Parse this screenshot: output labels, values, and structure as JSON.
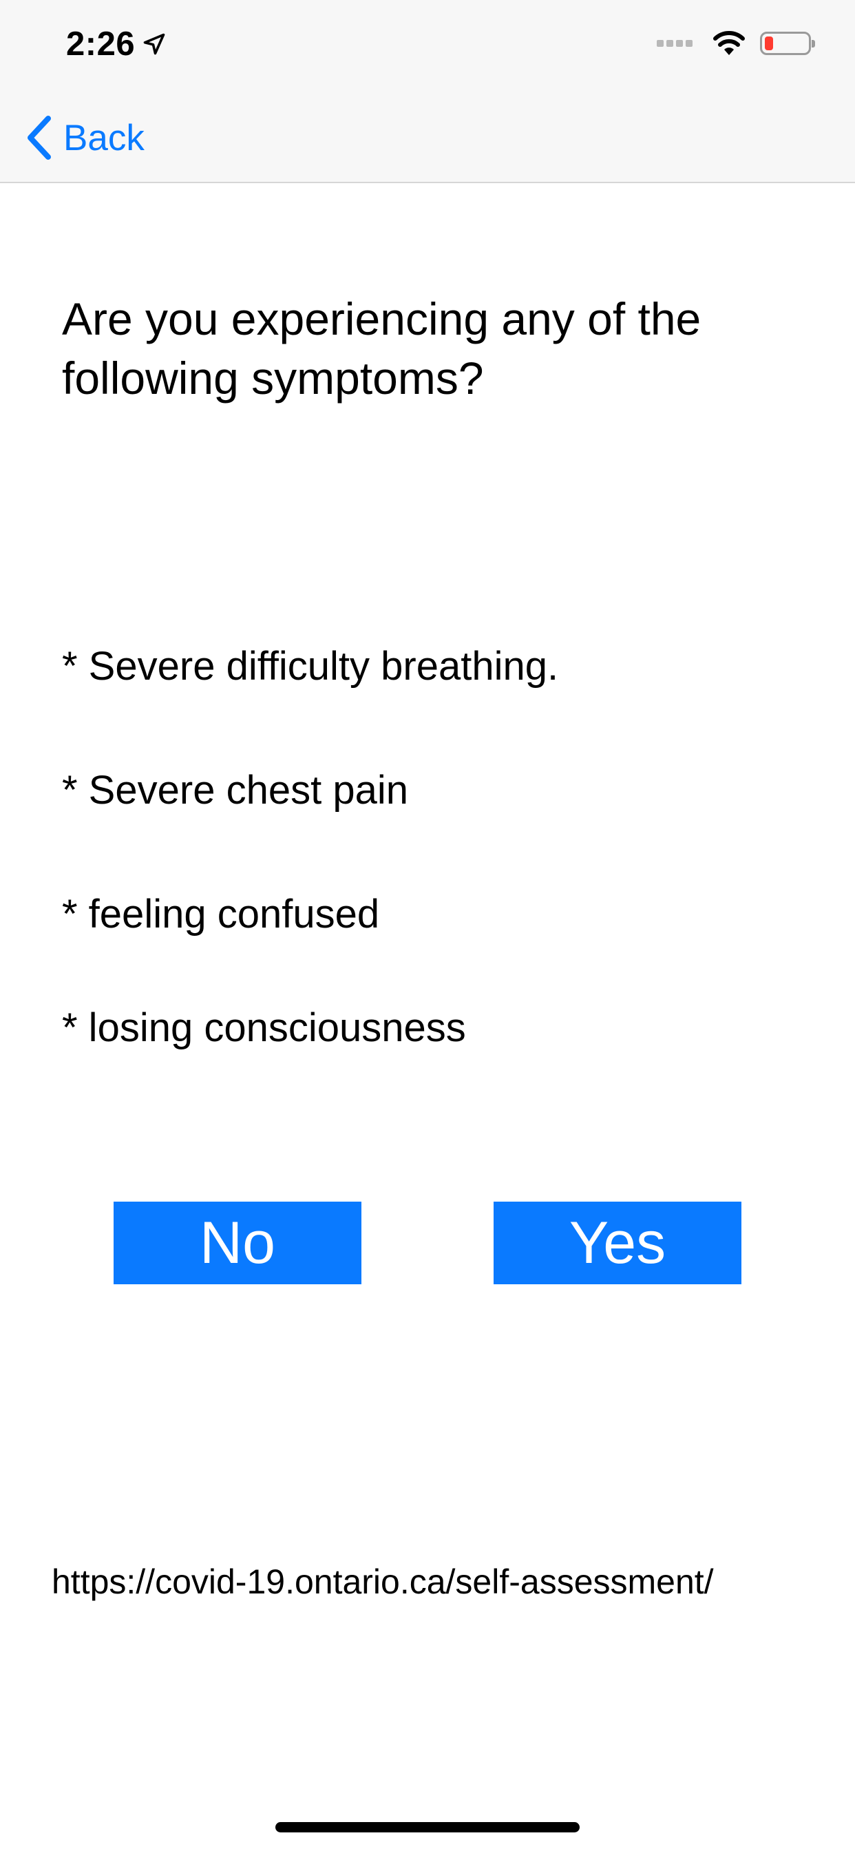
{
  "status_bar": {
    "time": "2:26",
    "location_icon": "location-arrow-icon",
    "wifi_icon": "wifi-icon",
    "battery_icon": "battery-low-icon",
    "battery_color": "#ff3b30"
  },
  "nav": {
    "back_label": "Back",
    "back_icon": "chevron-left-icon",
    "accent_color": "#0a7aff"
  },
  "question": {
    "text": "Are you experiencing any of the following symptoms?"
  },
  "symptoms": [
    "* Severe difficulty breathing.",
    "* Severe chest pain",
    "* feeling confused",
    "* losing consciousness"
  ],
  "actions": {
    "no_label": "No",
    "yes_label": "Yes",
    "button_color": "#0a7aff"
  },
  "footer": {
    "url": "https://covid-19.ontario.ca/self-assessment/"
  }
}
